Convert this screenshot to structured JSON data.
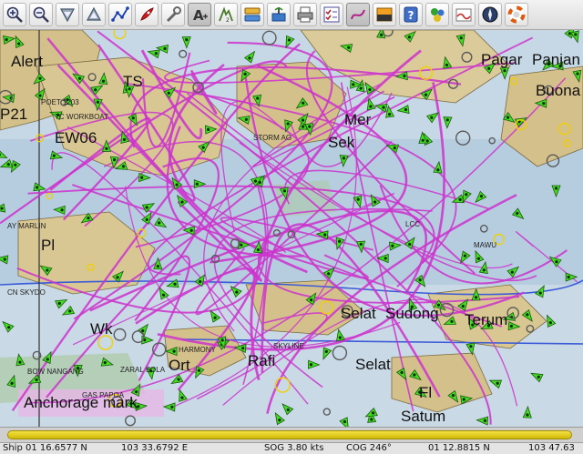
{
  "toolbar": {
    "buttons": [
      {
        "icon": "zoom-in-icon"
      },
      {
        "icon": "zoom-out-icon"
      },
      {
        "icon": "scale-in-icon"
      },
      {
        "icon": "scale-out-icon"
      },
      {
        "icon": "route-icon"
      },
      {
        "icon": "follow-ship-icon"
      },
      {
        "icon": "settings-wrench-icon"
      },
      {
        "icon": "text-toggle-icon"
      },
      {
        "icon": "current-tide-icon"
      },
      {
        "icon": "chart-groups-icon"
      },
      {
        "icon": "ais-targets-icon"
      },
      {
        "icon": "print-icon"
      },
      {
        "icon": "route-manager-icon"
      },
      {
        "icon": "track-icon"
      },
      {
        "icon": "color-scheme-icon"
      },
      {
        "icon": "help-icon"
      },
      {
        "icon": "gps-icon"
      },
      {
        "icon": "tides-icon"
      },
      {
        "icon": "compass-icon"
      },
      {
        "icon": "mob-lifebuoy-icon"
      }
    ]
  },
  "chart": {
    "labels_big": [
      "Alert",
      "TS",
      "Pagar",
      "Panjan",
      "Buona",
      "P21",
      "Mer",
      "EW06",
      "Sek",
      "Pl",
      "Terum",
      "Wk",
      "Selat",
      "Sudong",
      "Ort",
      "Rafi",
      "Selat",
      "Fl",
      "Anchorage mark",
      "Satum"
    ],
    "labels_small": [
      "TC WORKBOAT",
      "POET 1203",
      "STORM AG",
      "BOW NANGANG",
      "ZARAL SOLA",
      "GAS PAPOA",
      "AY MARLIN",
      "CN SKYDO",
      "LCC",
      "HARMONY",
      "MAWU",
      "SKYLINE"
    ]
  },
  "status": {
    "ship_pos": "Ship 01 16.6577 N",
    "ship_lon": "103 33.6792 E",
    "sog": "SOG 3.80 kts",
    "cog": "COG 246°",
    "cursor_lat": "01 12.8815 N",
    "cursor_lon": "103 47.63"
  },
  "colors": {
    "water": "#b6cde0",
    "land": "#d4c08a",
    "track": "#cc33cc",
    "ais_target": "#44dd22",
    "scroll_thumb": "#e3c822"
  }
}
